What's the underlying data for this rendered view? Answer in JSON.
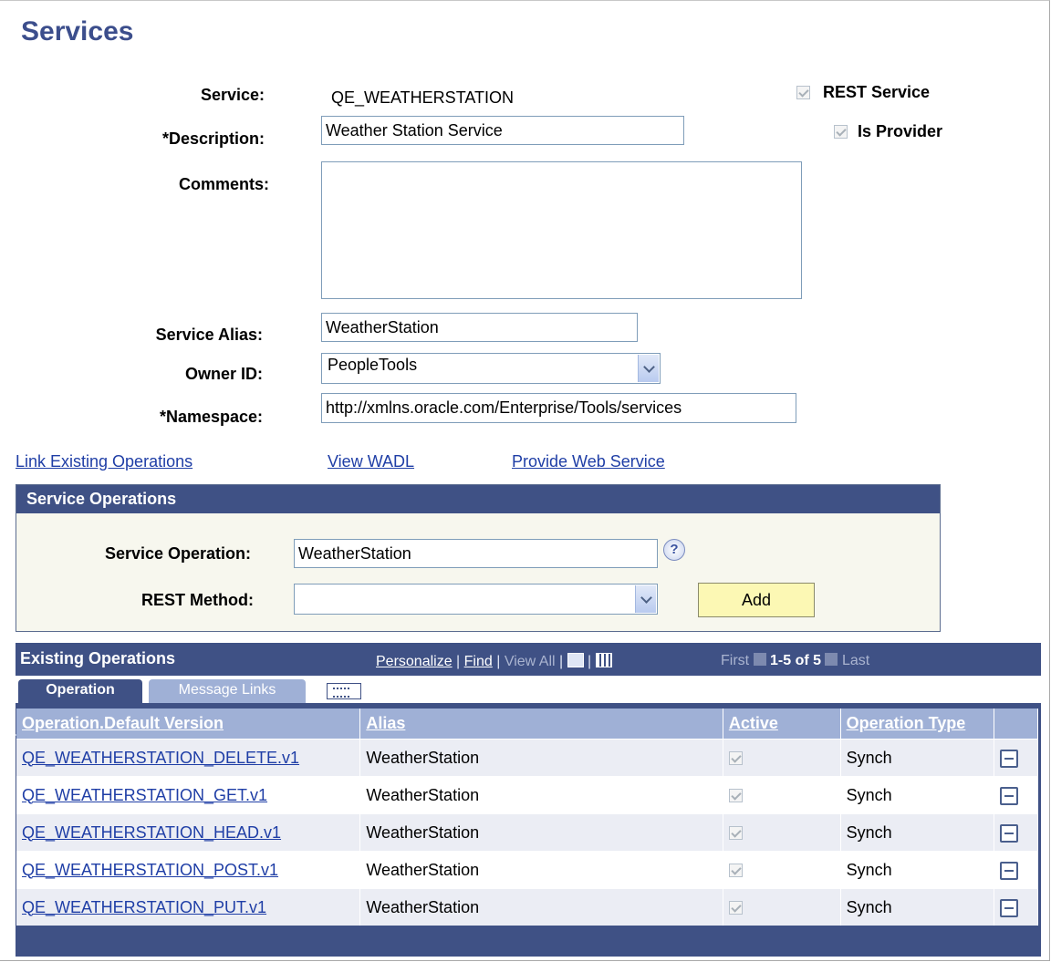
{
  "page": {
    "title": "Services"
  },
  "form": {
    "service_label": "Service:",
    "service_value": "QE_WEATHERSTATION",
    "description_label": "*Description:",
    "description_value": "Weather Station Service",
    "comments_label": "Comments:",
    "comments_value": "",
    "alias_label": "Service Alias:",
    "alias_value": "WeatherStation",
    "owner_label": "Owner ID:",
    "owner_value": "PeopleTools",
    "namespace_label": "*Namespace:",
    "namespace_value": "http://xmlns.oracle.com/Enterprise/Tools/services",
    "rest_service_label": "REST Service",
    "rest_service_checked": true,
    "is_provider_label": "Is Provider",
    "is_provider_checked": true
  },
  "links": {
    "link_existing": "Link Existing Operations",
    "view_wadl": "View WADL",
    "provide_ws": "Provide Web Service"
  },
  "service_ops": {
    "title": "Service Operations",
    "operation_label": "Service Operation:",
    "operation_value": "WeatherStation",
    "help_icon": "?",
    "method_label": "REST Method:",
    "method_value": "",
    "add_label": "Add"
  },
  "existing": {
    "title": "Existing Operations",
    "personalize": "Personalize",
    "sep1": " | ",
    "find": "Find",
    "sep2": " | ",
    "view_all": "View All",
    "sep3": " | ",
    "sep4": " | ",
    "first": "First",
    "range": "1-5 of 5",
    "last": "Last",
    "tabs": {
      "operation": "Operation",
      "message_links": "Message Links"
    },
    "columns": {
      "operation": "Operation.Default Version",
      "alias": "Alias",
      "active": "Active",
      "type": "Operation Type"
    },
    "rows": [
      {
        "operation": "QE_WEATHERSTATION_DELETE.v1",
        "alias": "WeatherStation",
        "active": true,
        "type": "Synch"
      },
      {
        "operation": "QE_WEATHERSTATION_GET.v1",
        "alias": "WeatherStation",
        "active": true,
        "type": "Synch"
      },
      {
        "operation": "QE_WEATHERSTATION_HEAD.v1",
        "alias": "WeatherStation",
        "active": true,
        "type": "Synch"
      },
      {
        "operation": "QE_WEATHERSTATION_POST.v1",
        "alias": "WeatherStation",
        "active": true,
        "type": "Synch"
      },
      {
        "operation": "QE_WEATHERSTATION_PUT.v1",
        "alias": "WeatherStation",
        "active": true,
        "type": "Synch"
      }
    ]
  },
  "icons": {
    "checkbox": "check-icon",
    "select": "chevron-down-icon",
    "help": "help-icon",
    "zoom": "zoom-icon",
    "download": "grid-download-icon",
    "prev": "arrow-left-icon",
    "next": "arrow-right-icon",
    "expand": "expand-tabs-icon",
    "delete": "minus-icon"
  },
  "colors": {
    "title": "#3c4e8c",
    "header_bar": "#3f5185",
    "column_header": "#9fb0d6",
    "link": "#1f3ea6",
    "button": "#fcf8b4",
    "panel_bg": "#f7f7ee"
  }
}
